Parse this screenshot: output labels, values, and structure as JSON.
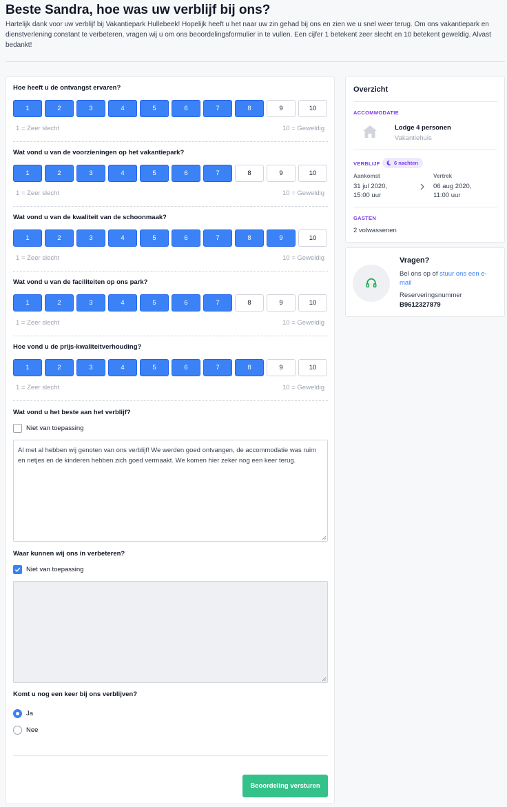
{
  "header": {
    "title": "Beste Sandra, hoe was uw verblijf bij ons?",
    "intro": "Hartelijk dank voor uw verblijf bij Vakantiepark Hullebeek! Hopelijk heeft u het naar uw zin gehad bij ons en zien we u snel weer terug. Om ons vakantiepark en dienstverlening constant te verbeteren, vragen wij u om ons beoordelingsformulier in te vullen. Een cijfer 1 betekent zeer slecht en 10 betekent geweldig. Alvast bedankt!"
  },
  "scale": {
    "low_label": "1 = Zeer slecht",
    "high_label": "10 = Geweldig"
  },
  "ratings": [
    {
      "question": "Hoe heeft u de ontvangst ervaren?",
      "value": 8
    },
    {
      "question": "Wat vond u van de voorzieningen op het vakantiepark?",
      "value": 7
    },
    {
      "question": "Wat vond u van de kwaliteit van de schoonmaak?",
      "value": 9
    },
    {
      "question": "Wat vond u van de faciliteiten op ons park?",
      "value": 7
    },
    {
      "question": "Hoe vond u de prijs-kwaliteitverhouding?",
      "value": 8
    }
  ],
  "best": {
    "question": "Wat vond u het beste aan het verblijf?",
    "not_applicable_label": "Niet van toepassing",
    "not_applicable_checked": false,
    "text": "Al met al hebben wij genoten van ons verblijf! We werden goed ontvangen, de accommodatie was ruim en netjes en de kinderen hebben zich goed vermaakt. We komen hier zeker nog een keer terug."
  },
  "improve": {
    "question": "Waar kunnen wij ons in verbeteren?",
    "not_applicable_label": "Niet van toepassing",
    "not_applicable_checked": true,
    "text": ""
  },
  "return_visit": {
    "question": "Komt u nog een keer bij ons verblijven?",
    "options": [
      "Ja",
      "Nee"
    ],
    "selected": "Ja"
  },
  "submit_label": "Beoordeling versturen",
  "overview": {
    "title": "Overzicht",
    "accommodation_label": "ACCOMMODATIE",
    "accommodation_name": "Lodge 4 personen",
    "accommodation_type": "Vakantiehuis",
    "stay_label": "VERBLIJF",
    "nights": "6 nachten",
    "arrival_label": "Aankomst",
    "arrival_value": "31 jul 2020, 15:00 uur",
    "departure_label": "Vertrek",
    "departure_value": "06 aug 2020, 11:00 uur",
    "guests_label": "GASTEN",
    "guests_value": "2 volwassenen"
  },
  "help": {
    "title": "Vragen?",
    "text_prefix": "Bel ons op of ",
    "link_text": "stuur ons een e-mail",
    "reservation_label": "Reserveringsnummer",
    "reservation_number": "B9612327879"
  },
  "colors": {
    "primary": "#3b82f6",
    "submit": "#34c28a",
    "accent": "#7c3aed"
  }
}
